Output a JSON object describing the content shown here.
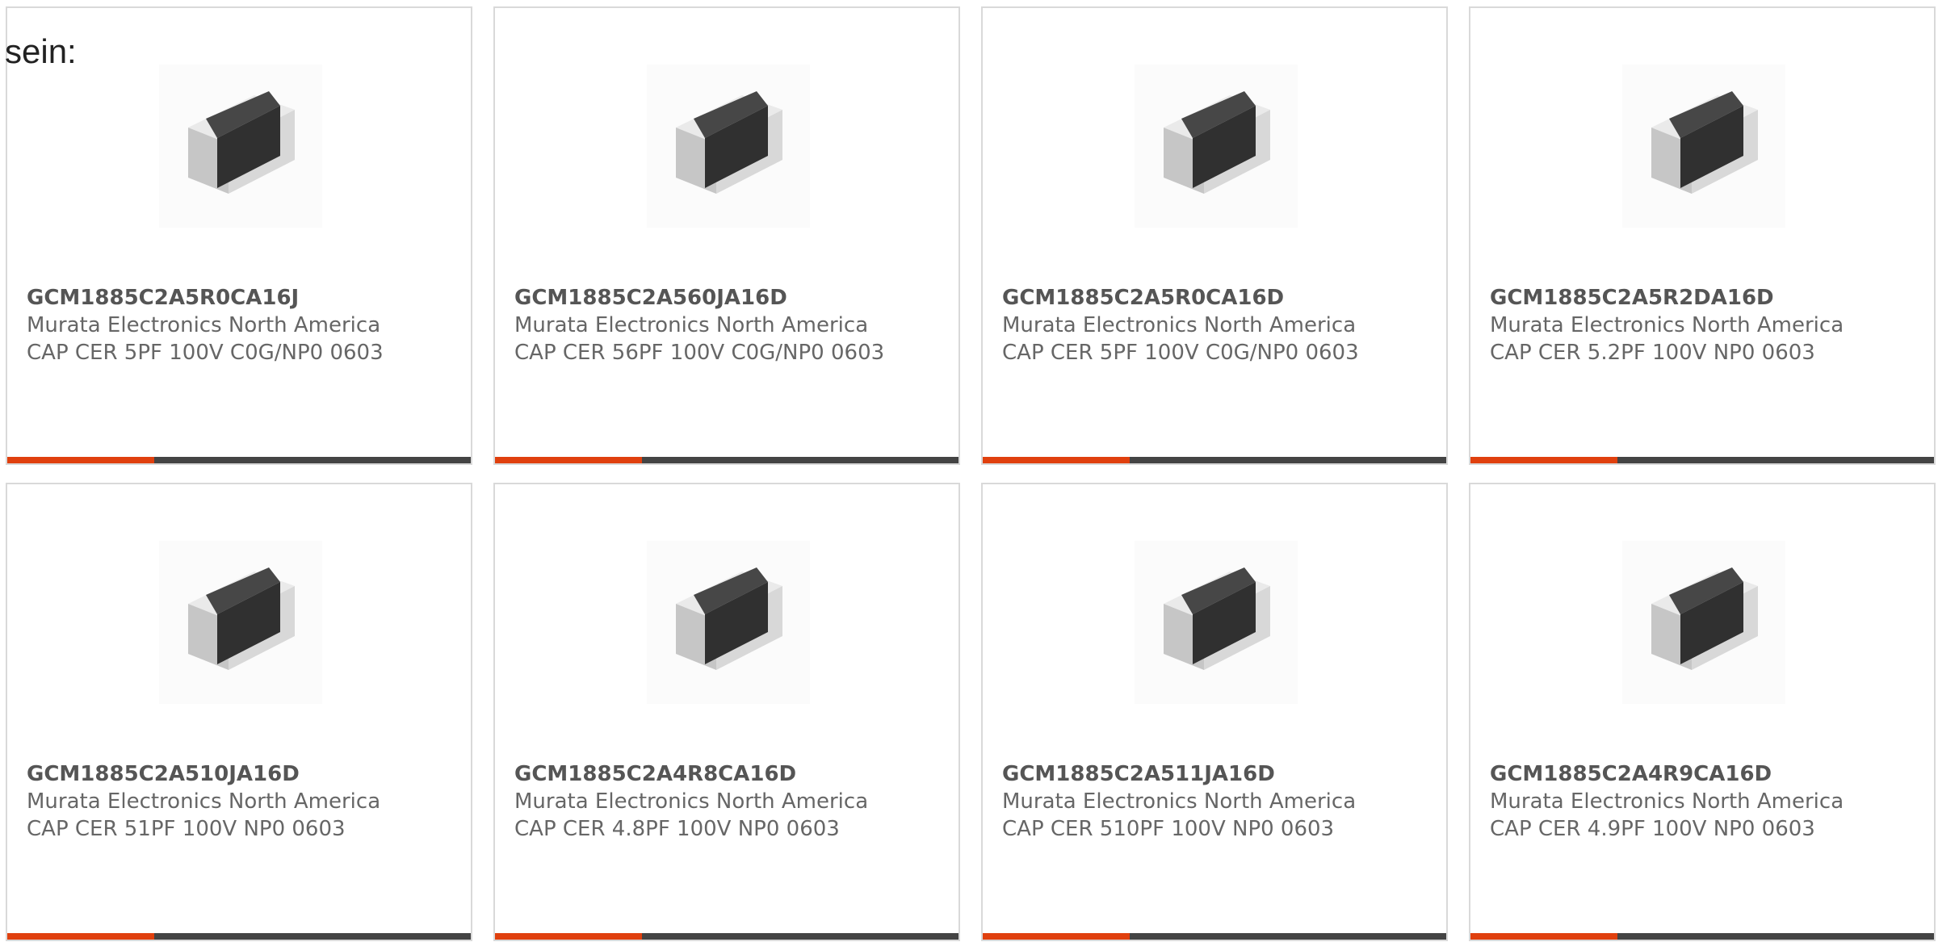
{
  "intro_text": "sein:",
  "colors": {
    "accent": "#e0400e",
    "bar": "#444444",
    "border": "#d9d9d9",
    "text": "#666666"
  },
  "products": [
    {
      "part_number": "GCM1885C2A5R0CA16J",
      "manufacturer": "Murata Electronics North America",
      "description": "CAP CER 5PF 100V C0G/NP0 0603",
      "image_icon": "ceramic-capacitor-chip-image"
    },
    {
      "part_number": "GCM1885C2A560JA16D",
      "manufacturer": "Murata Electronics North America",
      "description": "CAP CER 56PF 100V C0G/NP0 0603",
      "image_icon": "ceramic-capacitor-chip-image"
    },
    {
      "part_number": "GCM1885C2A5R0CA16D",
      "manufacturer": "Murata Electronics North America",
      "description": "CAP CER 5PF 100V C0G/NP0 0603",
      "image_icon": "ceramic-capacitor-chip-image"
    },
    {
      "part_number": "GCM1885C2A5R2DA16D",
      "manufacturer": "Murata Electronics North America",
      "description": "CAP CER 5.2PF 100V NP0 0603",
      "image_icon": "ceramic-capacitor-chip-image"
    },
    {
      "part_number": "GCM1885C2A510JA16D",
      "manufacturer": "Murata Electronics North America",
      "description": "CAP CER 51PF 100V NP0 0603",
      "image_icon": "ceramic-capacitor-chip-image"
    },
    {
      "part_number": "GCM1885C2A4R8CA16D",
      "manufacturer": "Murata Electronics North America",
      "description": "CAP CER 4.8PF 100V NP0 0603",
      "image_icon": "ceramic-capacitor-chip-image"
    },
    {
      "part_number": "GCM1885C2A511JA16D",
      "manufacturer": "Murata Electronics North America",
      "description": "CAP CER 510PF 100V NP0 0603",
      "image_icon": "ceramic-capacitor-chip-image"
    },
    {
      "part_number": "GCM1885C2A4R9CA16D",
      "manufacturer": "Murata Electronics North America",
      "description": "CAP CER 4.9PF 100V NP0 0603",
      "image_icon": "ceramic-capacitor-chip-image"
    }
  ]
}
